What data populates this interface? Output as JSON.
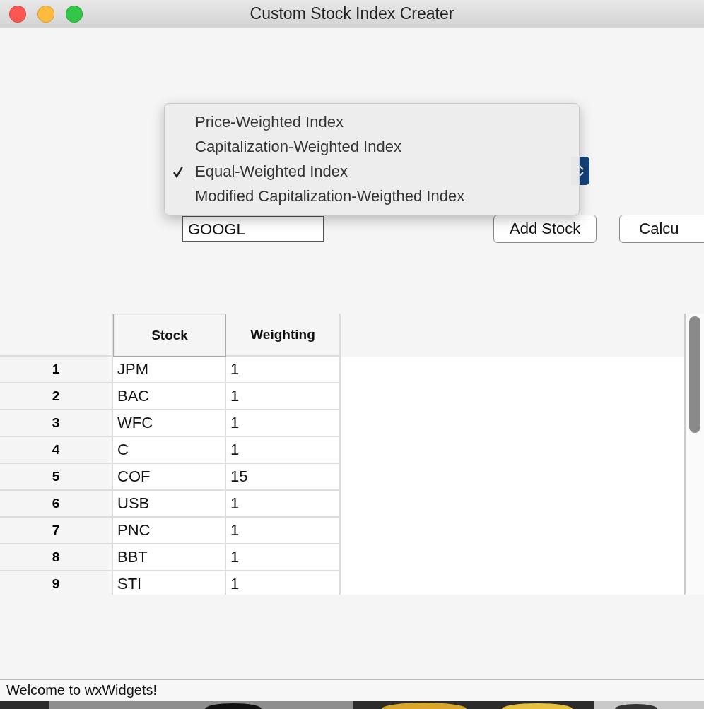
{
  "window": {
    "title": "Custom Stock Index Creater"
  },
  "index_menu": [
    {
      "label": "Price-Weighted Index",
      "selected": false
    },
    {
      "label": "Capitalization-Weighted Index",
      "selected": false
    },
    {
      "label": "Equal-Weighted Index",
      "selected": true
    },
    {
      "label": "Modified Capitalization-Weigthed Index",
      "selected": false
    }
  ],
  "symbol_field": {
    "value": "GOOGL"
  },
  "buttons": [
    "Add Stock",
    "Calcu"
  ],
  "table": {
    "columns": [
      "Stock",
      "Weighting"
    ],
    "rows": [
      {
        "row": "1",
        "stock": "JPM",
        "weighting": "1"
      },
      {
        "row": "2",
        "stock": "BAC",
        "weighting": "1"
      },
      {
        "row": "3",
        "stock": "WFC",
        "weighting": "1"
      },
      {
        "row": "4",
        "stock": "C",
        "weighting": "1"
      },
      {
        "row": "5",
        "stock": "COF",
        "weighting": "15"
      },
      {
        "row": "6",
        "stock": "USB",
        "weighting": "1"
      },
      {
        "row": "7",
        "stock": "PNC",
        "weighting": "1"
      },
      {
        "row": "8",
        "stock": "BBT",
        "weighting": "1"
      },
      {
        "row": "9",
        "stock": "STI",
        "weighting": "1"
      }
    ]
  },
  "status_bar": "Welcome to wxWidgets!"
}
